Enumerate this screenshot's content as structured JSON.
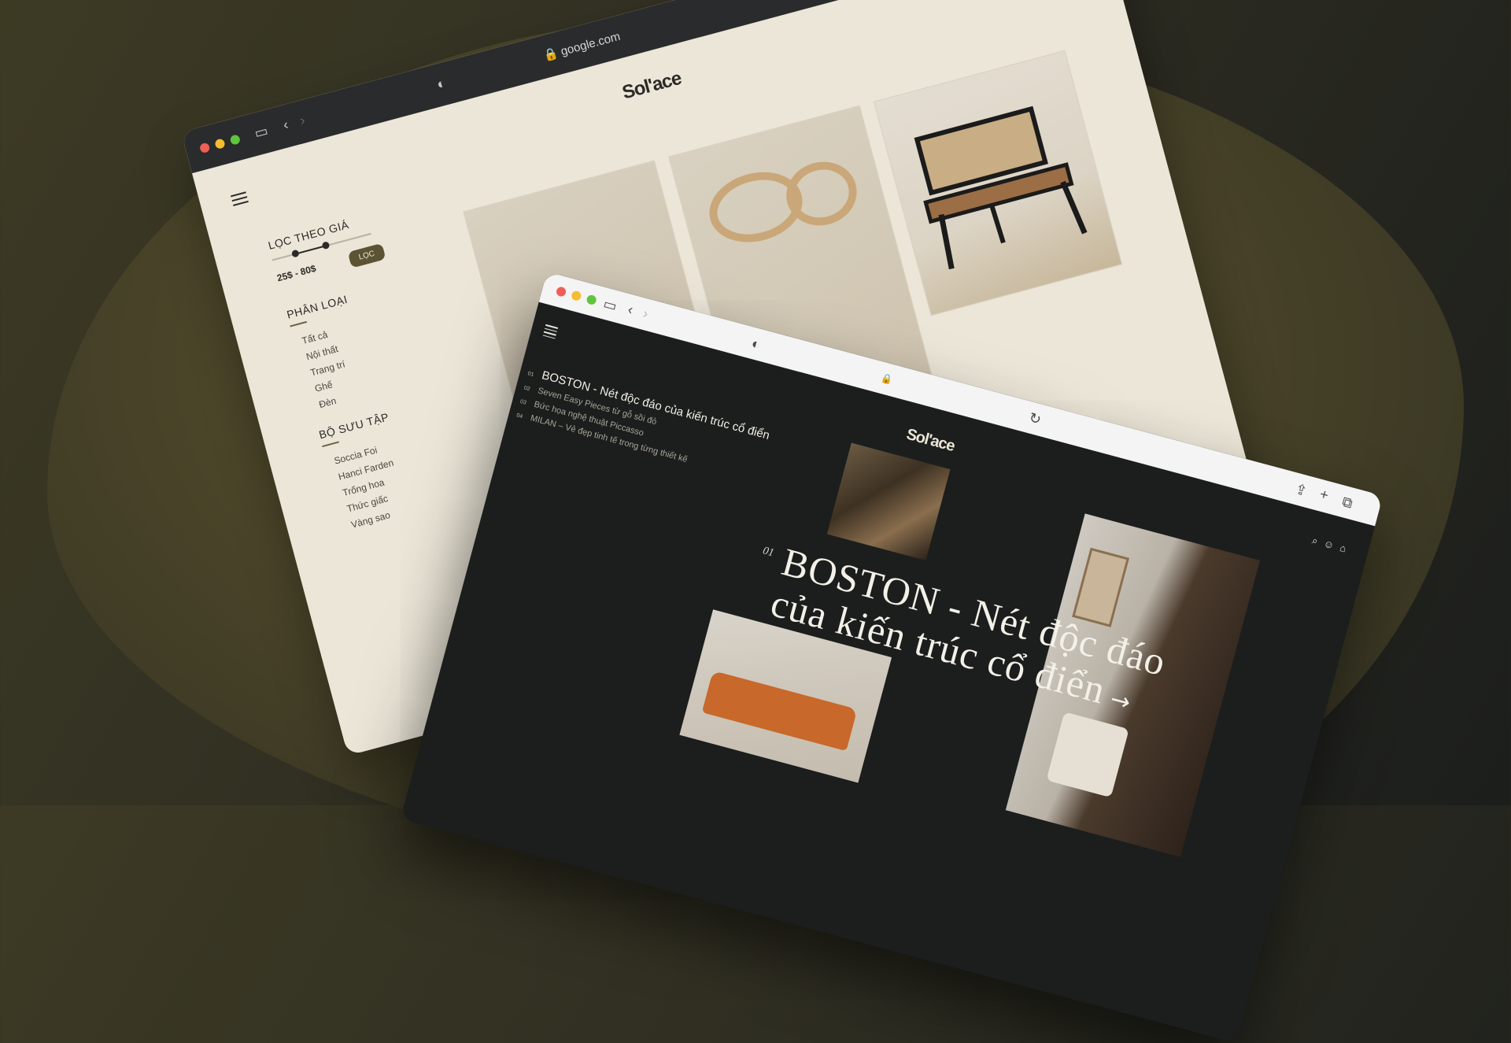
{
  "back_window": {
    "url": "google.com",
    "logo": "Sol'ace",
    "filter": {
      "title": "LỌC THEO GIÁ",
      "price_range": "25$ - 80$",
      "button": "LỌC"
    },
    "categories": {
      "title": "PHÂN LOẠI",
      "items": [
        "Tất cả",
        "Nội thất",
        "Trang trí",
        "Ghế",
        "Đèn"
      ]
    },
    "collections": {
      "title": "BỘ SƯU TẬP",
      "items": [
        "Soccia Foi",
        "Hanci Farden",
        "Trống hoa",
        "Thức giấc",
        "Vàng sao"
      ]
    }
  },
  "front_window": {
    "logo": "Sol'ace",
    "toc": [
      {
        "num": "01",
        "title": "BOSTON - Nét độc đáo của kiến trúc cổ điển"
      },
      {
        "num": "02",
        "title": "Seven Easy Pieces từ gỗ sồi đỏ"
      },
      {
        "num": "03",
        "title": "Bức họa nghệ thuật Piccasso"
      },
      {
        "num": "04",
        "title": "MILAN – Vẻ đẹp tinh tế trong từng thiết kế"
      }
    ],
    "hero": {
      "num": "01",
      "line1": "BOSTON - Nét độc đáo",
      "line2": "của kiến trúc cổ điển",
      "arrow": "→"
    }
  }
}
